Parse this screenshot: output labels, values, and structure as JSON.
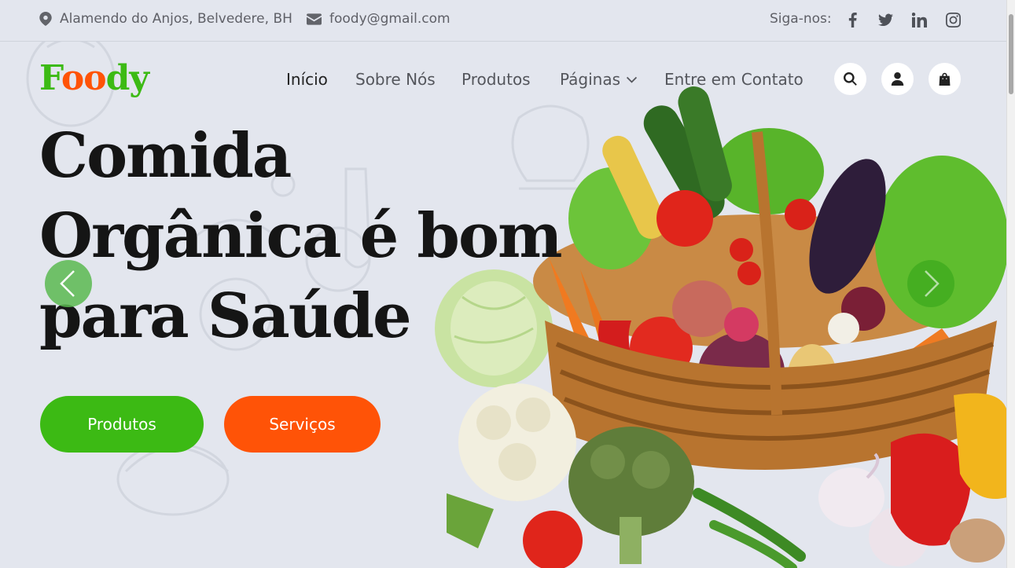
{
  "topbar": {
    "address": "Alamendo do Anjos, Belvedere, BH",
    "email": "foody@gmail.com",
    "follow_label": "Siga-nos:",
    "social_icons": [
      "facebook-icon",
      "twitter-icon",
      "linkedin-icon",
      "instagram-icon"
    ]
  },
  "brand": {
    "letters": [
      "F",
      "o",
      "o",
      "d",
      "y"
    ],
    "colors": {
      "green": "#3cba14",
      "orange": "#ff5307"
    }
  },
  "nav": {
    "items": [
      "Início",
      "Sobre Nós",
      "Produtos",
      "Páginas",
      "Entre em Contato"
    ],
    "active": "Início"
  },
  "hero": {
    "title_lines": [
      "Comida",
      "Orgânica é bom",
      "para Saúde"
    ],
    "primary_button": "Produtos",
    "secondary_button": "Serviços"
  },
  "colors": {
    "background": "#e3e6ee",
    "primary": "#3cba14",
    "secondary": "#ff5307",
    "heading": "#151515"
  }
}
